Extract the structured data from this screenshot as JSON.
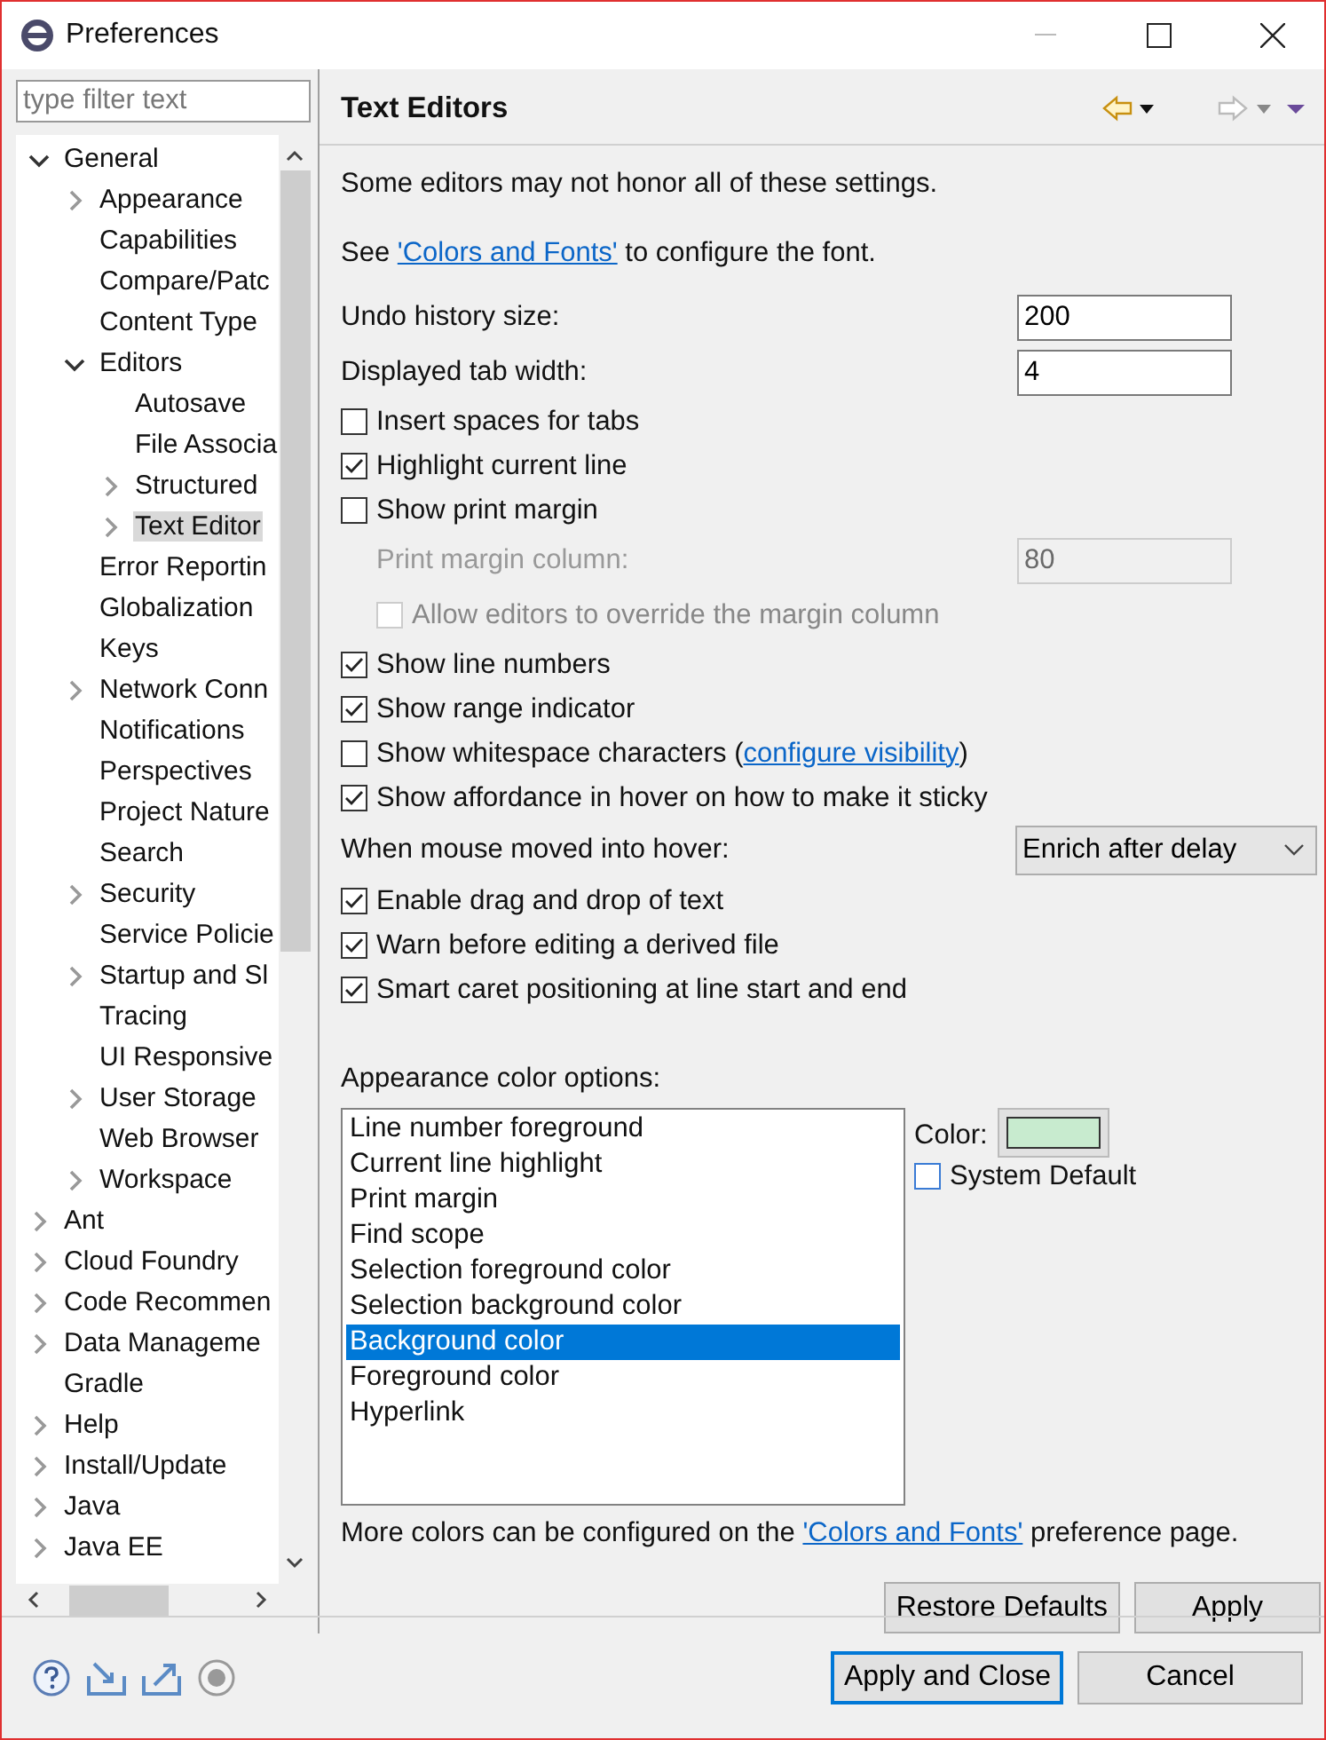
{
  "window": {
    "title": "Preferences"
  },
  "filter": {
    "placeholder": "type filter text"
  },
  "tree": [
    {
      "label": "General",
      "expanded": true,
      "selected": false,
      "children": [
        {
          "label": "Appearance",
          "expanded": false,
          "selected": false
        },
        {
          "label": "Capabilities",
          "selected": false
        },
        {
          "label": "Compare/Patc",
          "selected": false
        },
        {
          "label": "Content Type",
          "selected": false
        },
        {
          "label": "Editors",
          "expanded": true,
          "selected": false,
          "children": [
            {
              "label": "Autosave",
              "selected": false
            },
            {
              "label": "File Associa",
              "selected": false
            },
            {
              "label": "Structured",
              "expanded": false,
              "selected": false
            },
            {
              "label": "Text Editor",
              "expanded": false,
              "selected": true
            }
          ]
        },
        {
          "label": "Error Reportin",
          "selected": false
        },
        {
          "label": "Globalization",
          "selected": false
        },
        {
          "label": "Keys",
          "selected": false
        },
        {
          "label": "Network Conn",
          "expanded": false,
          "selected": false
        },
        {
          "label": "Notifications",
          "selected": false
        },
        {
          "label": "Perspectives",
          "selected": false
        },
        {
          "label": "Project Nature",
          "selected": false
        },
        {
          "label": "Search",
          "selected": false
        },
        {
          "label": "Security",
          "expanded": false,
          "selected": false
        },
        {
          "label": "Service Policie",
          "selected": false
        },
        {
          "label": "Startup and Sl",
          "expanded": false,
          "selected": false
        },
        {
          "label": "Tracing",
          "selected": false
        },
        {
          "label": "UI Responsive",
          "selected": false
        },
        {
          "label": "User Storage",
          "expanded": false,
          "selected": false
        },
        {
          "label": "Web Browser",
          "selected": false
        },
        {
          "label": "Workspace",
          "expanded": false,
          "selected": false
        }
      ]
    },
    {
      "label": "Ant",
      "expanded": false,
      "selected": false
    },
    {
      "label": "Cloud Foundry",
      "expanded": false,
      "selected": false
    },
    {
      "label": "Code Recommen",
      "expanded": false,
      "selected": false
    },
    {
      "label": "Data Manageme",
      "expanded": false,
      "selected": false
    },
    {
      "label": "Gradle",
      "selected": false
    },
    {
      "label": "Help",
      "expanded": false,
      "selected": false
    },
    {
      "label": "Install/Update",
      "expanded": false,
      "selected": false
    },
    {
      "label": "Java",
      "expanded": false,
      "selected": false
    },
    {
      "label": "Java EE",
      "expanded": false,
      "selected": false
    }
  ],
  "page": {
    "title": "Text Editors",
    "note": "Some editors may not honor all of these settings.",
    "font_hint": {
      "before": "See ",
      "link": "'Colors and Fonts'",
      "after": " to configure the font."
    },
    "settings": [
      {
        "kind": "number",
        "label": "Undo history size:",
        "value": "200",
        "disabled": false
      },
      {
        "kind": "number",
        "label": "Displayed tab width:",
        "value": "4",
        "disabled": false
      },
      {
        "kind": "checkbox",
        "label": "Insert spaces for tabs",
        "checked": false,
        "disabled": false
      },
      {
        "kind": "checkbox",
        "label": "Highlight current line",
        "checked": true,
        "disabled": false
      },
      {
        "kind": "checkbox",
        "label": "Show print margin",
        "checked": false,
        "disabled": false
      },
      {
        "kind": "number",
        "label": "Print margin column:",
        "value": "80",
        "disabled": true
      },
      {
        "kind": "checkbox",
        "label": "Allow editors to override the margin column",
        "checked": false,
        "disabled": true
      },
      {
        "kind": "checkbox",
        "label": "Show line numbers",
        "checked": true,
        "disabled": false
      },
      {
        "kind": "checkbox",
        "label": "Show range indicator",
        "checked": true,
        "disabled": false
      },
      {
        "kind": "checkbox",
        "label": "Show whitespace characters (",
        "link": "configure visibility",
        "after": ")",
        "checked": false,
        "disabled": false
      },
      {
        "kind": "checkbox",
        "label": "Show affordance in hover on how to make it sticky",
        "checked": true,
        "disabled": false
      },
      {
        "kind": "select",
        "label": "When mouse moved into hover:",
        "value": "Enrich after delay"
      },
      {
        "kind": "checkbox",
        "label": "Enable drag and drop of text",
        "checked": true,
        "disabled": false
      },
      {
        "kind": "checkbox",
        "label": "Warn before editing a derived file",
        "checked": true,
        "disabled": false
      },
      {
        "kind": "checkbox",
        "label": "Smart caret positioning at line start and end",
        "checked": true,
        "disabled": false
      }
    ],
    "colors": {
      "label": "Appearance color options:",
      "items": [
        {
          "label": "Line number foreground",
          "selected": false
        },
        {
          "label": "Current line highlight",
          "selected": false
        },
        {
          "label": "Print margin",
          "selected": false
        },
        {
          "label": "Find scope",
          "selected": false
        },
        {
          "label": "Selection foreground color",
          "selected": false
        },
        {
          "label": "Selection background color",
          "selected": false
        },
        {
          "label": "Background color",
          "selected": true
        },
        {
          "label": "Foreground color",
          "selected": false
        },
        {
          "label": "Hyperlink",
          "selected": false
        }
      ],
      "color_label": "Color:",
      "color": "#c8ebcf",
      "system_default": {
        "label": "System Default",
        "checked": false
      }
    },
    "footer_note": {
      "before": "More colors can be configured on the ",
      "link": "'Colors and Fonts'",
      "after": " preference page."
    },
    "buttons": [
      "Restore Defaults",
      "Apply"
    ]
  },
  "dialog_buttons": [
    {
      "label": "Apply and Close",
      "default": true
    },
    {
      "label": "Cancel",
      "default": false
    }
  ]
}
